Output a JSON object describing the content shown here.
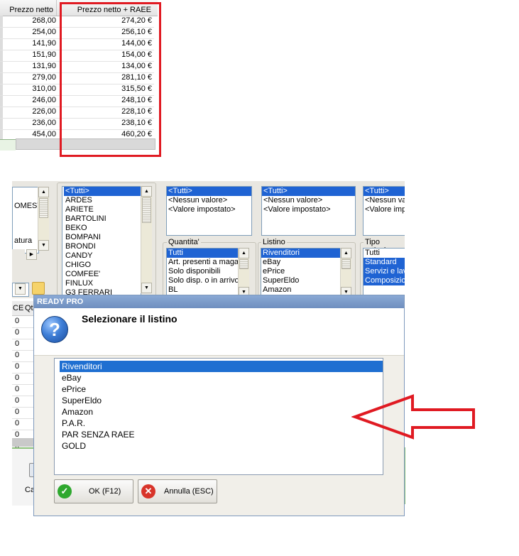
{
  "price_table": {
    "headers": {
      "net": "Prezzo netto",
      "net_raee": "Prezzo netto + RAEE"
    },
    "rows": [
      {
        "net": "268,00",
        "net_raee": "274,20 €"
      },
      {
        "net": "254,00",
        "net_raee": "256,10 €"
      },
      {
        "net": "141,90",
        "net_raee": "144,00 €"
      },
      {
        "net": "151,90",
        "net_raee": "154,00 €"
      },
      {
        "net": "131,90",
        "net_raee": "134,00 €"
      },
      {
        "net": "279,00",
        "net_raee": "281,10 €"
      },
      {
        "net": "310,00",
        "net_raee": "315,50 €"
      },
      {
        "net": "246,00",
        "net_raee": "248,10 €"
      },
      {
        "net": "226,00",
        "net_raee": "228,10 €"
      },
      {
        "net": "236,00",
        "net_raee": "238,10 €"
      },
      {
        "net": "454,00",
        "net_raee": "460,20 €"
      }
    ]
  },
  "filter_panel": {
    "left_list": [
      "OMESTI",
      "atura"
    ],
    "brand_list": [
      "<Tutti>",
      "ARDES",
      "ARIETE",
      "BARTOLINI",
      "BEKO",
      "BOMPANI",
      "BRONDI",
      "CANDY",
      "CHIGO",
      "COMFEE'",
      "FINLUX",
      "G3 FERRARI"
    ],
    "value_list_1": [
      "<Tutti>",
      "<Nessun valore>",
      "<Valore impostato>"
    ],
    "value_list_2": [
      "<Tutti>",
      "<Nessun valore>",
      "<Valore impostato>"
    ],
    "value_list_3": [
      "<Tutti>",
      "<Nessun valore>",
      "<Valore impo"
    ],
    "quantita": {
      "title": "Quantita'",
      "items": [
        "Tutti",
        "Art. presenti a maga",
        "Solo disponibili",
        "Solo disp. o in arrivo",
        "BL"
      ]
    },
    "listino": {
      "title": "Listino",
      "items": [
        "Rivenditori",
        "eBay",
        "ePrice",
        "SuperEldo",
        "Amazon"
      ]
    },
    "tipo_articolo": {
      "title": "Tipo articolo",
      "items": [
        "Tutti",
        "Standard",
        "Servizi e lav",
        "Composizion"
      ]
    }
  },
  "bg_grid": {
    "headers": [
      "CE",
      "Qt"
    ],
    "values": [
      "0",
      "0",
      "0",
      "0",
      "0",
      "0",
      "0",
      "0",
      "0",
      "0",
      "0",
      "0"
    ],
    "footer_label": "Ca"
  },
  "dialog": {
    "title": "READY PRO",
    "message": "Selezionare il listino",
    "options": [
      "Rivenditori",
      "eBay",
      "ePrice",
      "SuperEldo",
      "Amazon",
      "P.A.R.",
      "PAR SENZA RAEE",
      "GOLD"
    ],
    "selected": "Rivenditori",
    "ok_label": "OK (F12)",
    "cancel_label": "Annulla (ESC)"
  },
  "colors": {
    "highlight_red": "#e01a22",
    "selection_blue": "#1f6fd1",
    "title_bar": "#7f9fcf"
  }
}
